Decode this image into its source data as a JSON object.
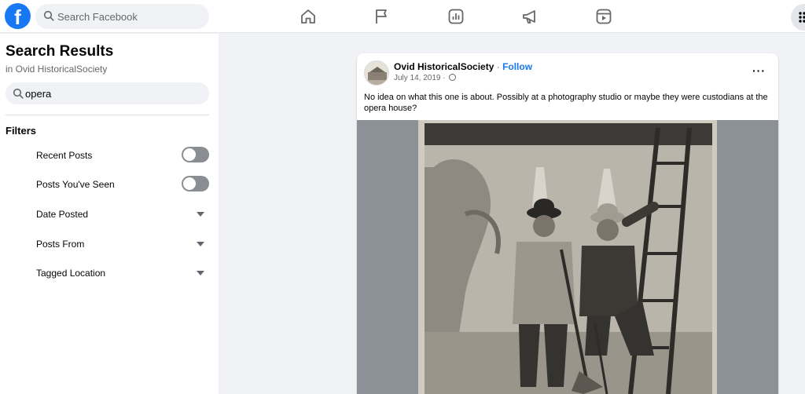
{
  "topbar": {
    "logo": "f",
    "search_placeholder": "Search Facebook",
    "nav_icons": [
      "home-icon",
      "flag-icon",
      "chart-icon",
      "megaphone-icon",
      "video-icon"
    ]
  },
  "left": {
    "title": "Search Results",
    "subtitle": "in Ovid HistoricalSociety",
    "query": "opera",
    "filters_title": "Filters",
    "filters": [
      {
        "label": "Recent Posts",
        "control": "toggle"
      },
      {
        "label": "Posts You've Seen",
        "control": "toggle"
      },
      {
        "label": "Date Posted",
        "control": "dropdown"
      },
      {
        "label": "Posts From",
        "control": "dropdown"
      },
      {
        "label": "Tagged Location",
        "control": "dropdown"
      }
    ]
  },
  "post": {
    "author": "Ovid HistoricalSociety",
    "separator": " · ",
    "follow": "Follow",
    "date": "July 14, 2019 · ",
    "more": "···",
    "text": "No idea on what this one is about. Possibly at a photography studio or maybe they were custodians at the opera house?"
  },
  "colors": {
    "brand": "#1877f2",
    "page_bg": "#f0f2f5",
    "media_bg": "#8c9097"
  }
}
